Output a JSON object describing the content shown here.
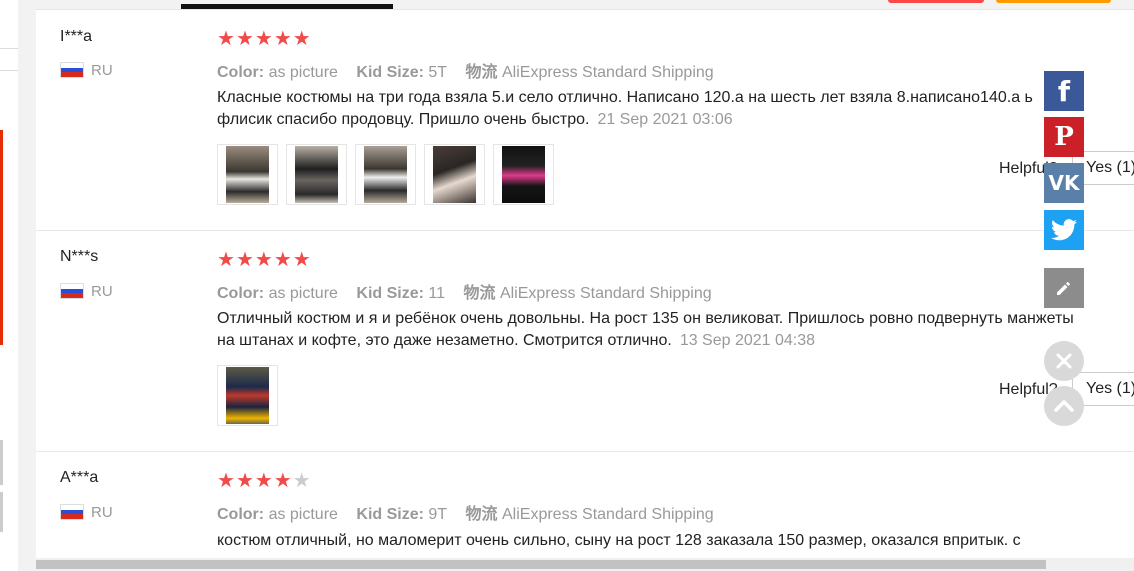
{
  "reviews": [
    {
      "user": "I***a",
      "country": "RU",
      "rating": 5,
      "color_label": "Color:",
      "color_value": "as picture",
      "size_label": "Kid Size:",
      "size_value": "5T",
      "shipping_label": "物流",
      "shipping_value": "AliExpress Standard Shipping",
      "text": "Класные костюмы на три года взяла 5.и село отлично. Написано 120.а на шесть лет взяла 8.написано140.а ь флисик спасибо продовцу. Пришло очень быстро.",
      "date": "21 Sep 2021 03:06",
      "photo_count": 5,
      "helpful_label": "Helpful?",
      "yes_label": "Yes (1)"
    },
    {
      "user": "N***s",
      "country": "RU",
      "rating": 5,
      "color_label": "Color:",
      "color_value": "as picture",
      "size_label": "Kid Size:",
      "size_value": "11",
      "shipping_label": "物流",
      "shipping_value": "AliExpress Standard Shipping",
      "text": "Отличный костюм и я и ребёнок очень довольны. На рост 135 он великоват. Пришлось ровно подвернуть манжеты на штанах и кофте, это даже незаметно. Смотрится отлично.",
      "date": "13 Sep 2021 04:38",
      "photo_count": 1,
      "helpful_label": "Helpful?",
      "yes_label": "Yes (1)"
    },
    {
      "user": "A***a",
      "country": "RU",
      "rating": 4,
      "color_label": "Color:",
      "color_value": "as picture",
      "size_label": "Kid Size:",
      "size_value": "9T",
      "shipping_label": "物流",
      "shipping_value": "AliExpress Standard Shipping",
      "text": "костюм отличный, но маломерит очень сильно, сыну на рост 128 заказала 150 размер, оказался впритык. с"
    }
  ],
  "share": {
    "facebook": "f",
    "pinterest": "P",
    "vk": "VK",
    "twitter": "twitter-icon",
    "edit": "pencil-icon"
  },
  "colors": {
    "star_on": "#f04a4a",
    "star_off": "#cccccc",
    "facebook": "#3b5998",
    "pinterest": "#cb2027",
    "vk": "#5a7fa8",
    "twitter": "#1da1f2"
  }
}
